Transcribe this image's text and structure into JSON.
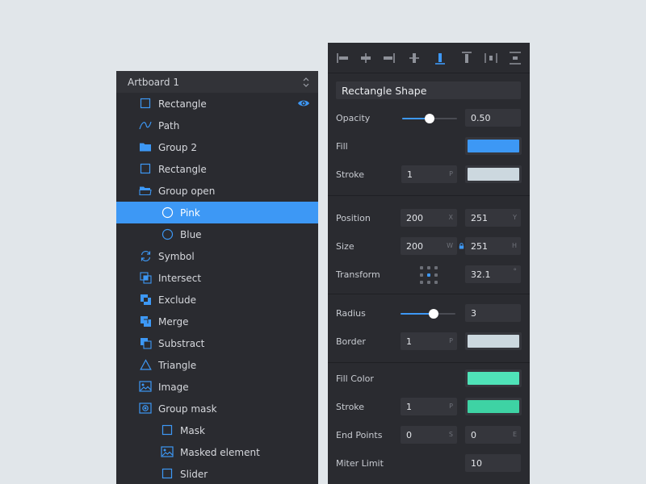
{
  "layers_panel": {
    "artboard_title": "Artboard 1",
    "items": [
      {
        "label": "Rectangle",
        "icon": "rectangle-icon",
        "level": 1,
        "selected": false,
        "visibility": true
      },
      {
        "label": "Path",
        "icon": "path-icon",
        "level": 1,
        "selected": false
      },
      {
        "label": "Group 2",
        "icon": "folder-icon",
        "level": 1,
        "selected": false
      },
      {
        "label": "Rectangle",
        "icon": "rectangle-icon",
        "level": 1,
        "selected": false
      },
      {
        "label": "Group open",
        "icon": "folder-open-icon",
        "level": 1,
        "selected": false
      },
      {
        "label": "Pink",
        "icon": "circle-icon",
        "level": 2,
        "selected": true
      },
      {
        "label": "Blue",
        "icon": "circle-icon",
        "level": 2,
        "selected": false
      },
      {
        "label": "Symbol",
        "icon": "symbol-icon",
        "level": 1,
        "selected": false
      },
      {
        "label": "Intersect",
        "icon": "intersect-icon",
        "level": 1,
        "selected": false
      },
      {
        "label": "Exclude",
        "icon": "exclude-icon",
        "level": 1,
        "selected": false
      },
      {
        "label": "Merge",
        "icon": "merge-icon",
        "level": 1,
        "selected": false
      },
      {
        "label": "Substract",
        "icon": "subtract-icon",
        "level": 1,
        "selected": false
      },
      {
        "label": "Triangle",
        "icon": "triangle-icon",
        "level": 1,
        "selected": false
      },
      {
        "label": "Image",
        "icon": "image-icon",
        "level": 1,
        "selected": false
      },
      {
        "label": "Group mask",
        "icon": "mask-group-icon",
        "level": 1,
        "selected": false
      },
      {
        "label": "Mask",
        "icon": "rectangle-icon",
        "level": 2,
        "selected": false
      },
      {
        "label": "Masked element",
        "icon": "image-icon",
        "level": 2,
        "selected": false
      },
      {
        "label": "Slider",
        "icon": "rectangle-icon",
        "level": 2,
        "selected": false
      }
    ]
  },
  "inspector": {
    "align_tools": [
      "align-left-icon",
      "align-center-h-icon",
      "align-right-icon",
      "align-center-v-icon",
      "align-bottom-icon",
      "align-top-icon",
      "distribute-h-icon",
      "distribute-v-icon"
    ],
    "shape_name": "Rectangle Shape",
    "opacity": {
      "label": "Opacity",
      "value": "0.50",
      "slider_fraction": 0.5
    },
    "fill": {
      "label": "Fill",
      "color": "#3d98f5"
    },
    "stroke": {
      "label": "Stroke",
      "width": "1",
      "unit": "P",
      "color": "#ccd8df"
    },
    "position": {
      "label": "Position",
      "x": "200",
      "x_unit": "X",
      "y": "251",
      "y_unit": "Y"
    },
    "size": {
      "label": "Size",
      "w": "200",
      "w_unit": "W",
      "h": "251",
      "h_unit": "H"
    },
    "transform": {
      "label": "Transform",
      "angle": "32.1",
      "angle_unit": "°"
    },
    "radius": {
      "label": "Radius",
      "value": "3",
      "slider_fraction": 0.6
    },
    "border": {
      "label": "Border",
      "width": "1",
      "unit": "P",
      "color": "#ccd8df"
    },
    "fill_color": {
      "label": "Fill Color",
      "color": "#4fe3b8"
    },
    "stroke2": {
      "label": "Stroke",
      "width": "1",
      "unit": "P",
      "color": "#3ed3a4"
    },
    "end_points": {
      "label": "End Points",
      "start": "0",
      "start_unit": "S",
      "end": "0",
      "end_unit": "E"
    },
    "miter_limit": {
      "label": "Miter Limit",
      "value": "10"
    }
  },
  "colors": {
    "accent": "#3d98f5",
    "panel": "#2a2b30",
    "field": "#35363c",
    "background": "#e1e6ea"
  }
}
